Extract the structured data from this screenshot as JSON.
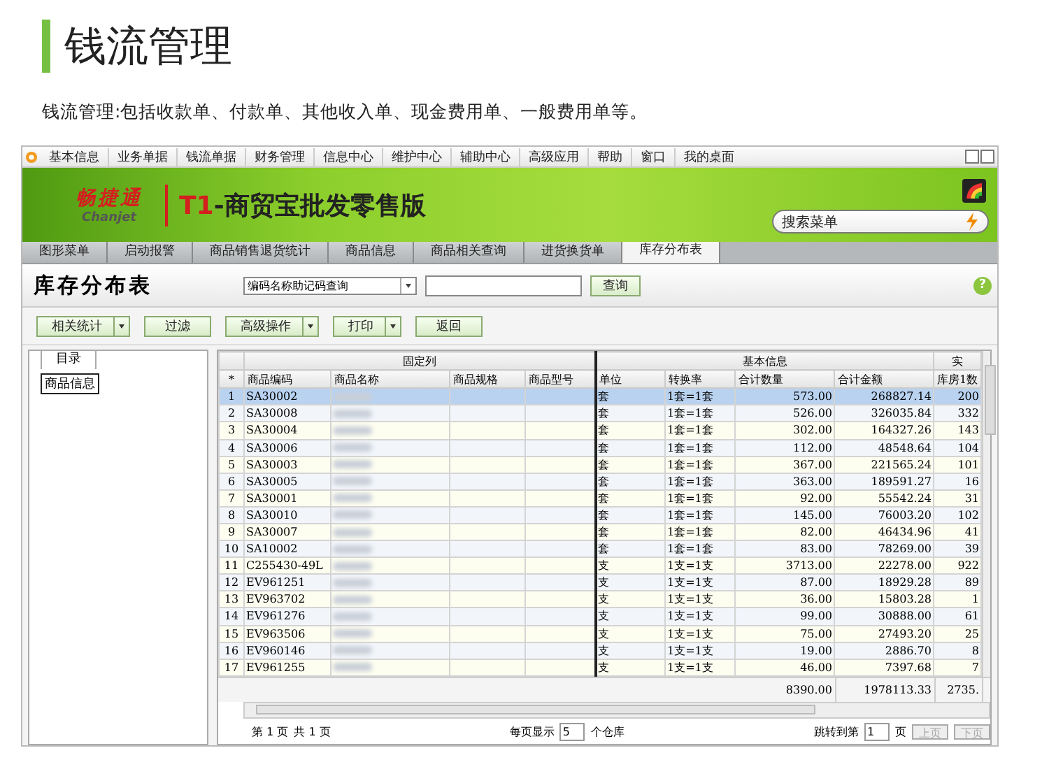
{
  "page": {
    "title": "钱流管理",
    "description": "钱流管理:包括收款单、付款单、其他收入单、现金费用单、一般费用单等。"
  },
  "app": {
    "menu": [
      "基本信息",
      "业务单据",
      "钱流单据",
      "财务管理",
      "信息中心",
      "维护中心",
      "辅助中心",
      "高级应用",
      "帮助",
      "窗口",
      "我的桌面"
    ],
    "brand": {
      "logo_cn": "畅捷通",
      "logo_en": "Chanjet",
      "product_code": "T1",
      "product_name": "-商贸宝批发零售版"
    },
    "search": {
      "placeholder": "搜索菜单"
    },
    "tabs": [
      {
        "label": "图形菜单",
        "selected": false
      },
      {
        "label": "启动报警",
        "selected": false
      },
      {
        "label": "商品销售退货统计",
        "selected": false
      },
      {
        "label": "商品信息",
        "selected": false
      },
      {
        "label": "商品相关查询",
        "selected": false
      },
      {
        "label": "进货换货单",
        "selected": false
      },
      {
        "label": "库存分布表",
        "selected": true
      }
    ],
    "report": {
      "title": "库存分布表",
      "query_mode": "编码名称助记码查询",
      "query_button": "查询",
      "help": "?",
      "toolbar": [
        {
          "label": "相关统计",
          "kind": "dropdown"
        },
        {
          "label": "过滤",
          "kind": "plain"
        },
        {
          "label": "高级操作",
          "kind": "dropdown"
        },
        {
          "label": "打印",
          "kind": "dropdown"
        },
        {
          "label": "返回",
          "kind": "plain"
        }
      ]
    },
    "tree": {
      "tab": "目录",
      "items": [
        {
          "label": "商品信息",
          "selected": true
        }
      ]
    },
    "table": {
      "corner": "*",
      "groups": [
        {
          "label": "固定列"
        },
        {
          "label": "基本信息"
        },
        {
          "label": "实"
        }
      ],
      "columns": [
        "商品编码",
        "商品名称",
        "商品规格",
        "商品型号",
        "单位",
        "转换率",
        "合计数量",
        "合计金额",
        "库房1数"
      ],
      "rows": [
        {
          "index": "1",
          "code": "SA30002",
          "unit": "套",
          "rate": "1套=1套",
          "qty": "573.00",
          "amount": "268827.14",
          "stock": "200",
          "selected": true
        },
        {
          "index": "2",
          "code": "SA30008",
          "unit": "套",
          "rate": "1套=1套",
          "qty": "526.00",
          "amount": "326035.84",
          "stock": "332",
          "selected": false
        },
        {
          "index": "3",
          "code": "SA30004",
          "unit": "套",
          "rate": "1套=1套",
          "qty": "302.00",
          "amount": "164327.26",
          "stock": "143",
          "selected": false
        },
        {
          "index": "4",
          "code": "SA30006",
          "unit": "套",
          "rate": "1套=1套",
          "qty": "112.00",
          "amount": "48548.64",
          "stock": "104",
          "selected": false
        },
        {
          "index": "5",
          "code": "SA30003",
          "unit": "套",
          "rate": "1套=1套",
          "qty": "367.00",
          "amount": "221565.24",
          "stock": "101",
          "selected": false
        },
        {
          "index": "6",
          "code": "SA30005",
          "unit": "套",
          "rate": "1套=1套",
          "qty": "363.00",
          "amount": "189591.27",
          "stock": "16",
          "selected": false
        },
        {
          "index": "7",
          "code": "SA30001",
          "unit": "套",
          "rate": "1套=1套",
          "qty": "92.00",
          "amount": "55542.24",
          "stock": "31",
          "selected": false
        },
        {
          "index": "8",
          "code": "SA30010",
          "unit": "套",
          "rate": "1套=1套",
          "qty": "145.00",
          "amount": "76003.20",
          "stock": "102",
          "selected": false
        },
        {
          "index": "9",
          "code": "SA30007",
          "unit": "套",
          "rate": "1套=1套",
          "qty": "82.00",
          "amount": "46434.96",
          "stock": "41",
          "selected": false
        },
        {
          "index": "10",
          "code": "SA10002",
          "unit": "套",
          "rate": "1套=1套",
          "qty": "83.00",
          "amount": "78269.00",
          "stock": "39",
          "selected": false
        },
        {
          "index": "11",
          "code": "C255430-49L",
          "unit": "支",
          "rate": "1支=1支",
          "qty": "3713.00",
          "amount": "22278.00",
          "stock": "922",
          "selected": false
        },
        {
          "index": "12",
          "code": "EV961251",
          "unit": "支",
          "rate": "1支=1支",
          "qty": "87.00",
          "amount": "18929.28",
          "stock": "89",
          "selected": false
        },
        {
          "index": "13",
          "code": "EV963702",
          "unit": "支",
          "rate": "1支=1支",
          "qty": "36.00",
          "amount": "15803.28",
          "stock": "1",
          "selected": false
        },
        {
          "index": "14",
          "code": "EV961276",
          "unit": "支",
          "rate": "1支=1支",
          "qty": "99.00",
          "amount": "30888.00",
          "stock": "61",
          "selected": false
        },
        {
          "index": "15",
          "code": "EV963506",
          "unit": "支",
          "rate": "1支=1支",
          "qty": "75.00",
          "amount": "27493.20",
          "stock": "25",
          "selected": false
        },
        {
          "index": "16",
          "code": "EV960146",
          "unit": "支",
          "rate": "1支=1支",
          "qty": "19.00",
          "amount": "2886.70",
          "stock": "8",
          "selected": false
        },
        {
          "index": "17",
          "code": "EV961255",
          "unit": "支",
          "rate": "1支=1支",
          "qty": "46.00",
          "amount": "7397.68",
          "stock": "7",
          "selected": false
        }
      ],
      "totals": {
        "qty": "8390.00",
        "amount": "1978113.33",
        "stock": "2735."
      }
    },
    "pager": {
      "page": "第 1 页",
      "total": "共 1 页",
      "per_page_label": "每页显示",
      "per_page": "5",
      "per_page_unit": "个仓库",
      "jump_label": "跳转到第",
      "jump_value": "1",
      "jump_unit": "页",
      "buttons": [
        {
          "label": "上页",
          "disabled": true
        },
        {
          "label": "下页",
          "disabled": true
        }
      ]
    }
  }
}
